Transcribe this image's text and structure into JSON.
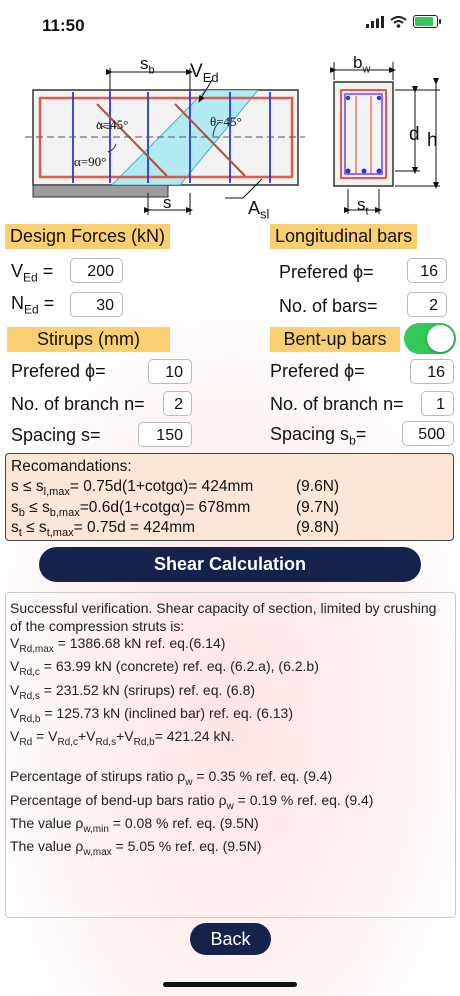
{
  "status_bar": {
    "time": "11:50"
  },
  "diagram_labels": {
    "sb": "s",
    "sb_sub": "b",
    "ved": "V",
    "ved_sub": "Ed",
    "alpha45": "α=45°",
    "theta45": "θ=45°",
    "alpha90": "α=90°",
    "s": "s",
    "asl": "A",
    "asl_sub": "sl",
    "bw": "b",
    "bw_sub": "w",
    "d": "d",
    "h": "h",
    "st": "s",
    "st_sub": "t"
  },
  "design_forces": {
    "title": "Design Forces (kN)",
    "ved_label": "V",
    "ved_sub": "Ed",
    "ved_value": "200",
    "ned_label": "N",
    "ned_sub": "Ed",
    "ned_value": "30"
  },
  "longitudinal": {
    "title": "Longitudinal bars",
    "phi_label": "Prefered ϕ=",
    "phi_value": "16",
    "bars_label": "No. of bars=",
    "bars_value": "2"
  },
  "stirups": {
    "title": "Stirups (mm)",
    "phi_label": "Prefered ϕ=",
    "phi_value": "10",
    "branch_label": "No. of branch n=",
    "branch_value": "2",
    "spacing_label": "Spacing s=",
    "spacing_value": "150"
  },
  "bentup": {
    "title": "Bent-up bars",
    "enabled": true,
    "phi_label": "Prefered ϕ=",
    "phi_value": "16",
    "branch_label": "No. of branch n=",
    "branch_value": "1",
    "spacing_label": "Spacing s",
    "spacing_sub": "b",
    "spacing_eq": "=",
    "spacing_value": "500"
  },
  "recommendations": {
    "title": "Recomandations:",
    "l1_a": "s ≤ s",
    "l1_sub": "l,max",
    "l1_b": "= 0.75d(1+cotgα)= 424mm",
    "l1_ref": "(9.6N)",
    "l2_a": "s",
    "l2_sub1": "b",
    "l2_b": " ≤ s",
    "l2_sub2": "b,max",
    "l2_c": "=0.6d(1+cotgα)= 678mm",
    "l2_ref": "(9.7N)",
    "l3_a": "s",
    "l3_sub1": "t",
    "l3_b": " ≤ s",
    "l3_sub2": "t,max",
    "l3_c": "= 0.75d = 424mm",
    "l3_ref": "(9.8N)"
  },
  "shear_button": "Shear Calculation",
  "results": {
    "intro": "Successful verification. Shear capacity of section, limited by crushing of the compression struts is:",
    "r1_a": "V",
    "r1_sub": "Rd,max",
    "r1_b": " = 1386.68 kN ref. eq.(6.14)",
    "r2_a": "V",
    "r2_sub": "Rd,c",
    "r2_b": " = 63.99 kN (concrete) ref. eq. (6.2.a), (6.2.b)",
    "r3_a": "V",
    "r3_sub": "Rd,s",
    "r3_b": " = 231.52 kN (srirups) ref. eq. (6.8)",
    "r4_a": "V",
    "r4_sub": "Rd,b",
    "r4_b": " = 125.73 kN (inclined bar) ref. eq. (6.13)",
    "r5_a": "V",
    "r5_sub": "Rd",
    "r5_b": " = V",
    "r5_sub2": "Rd,c",
    "r5_c": "+V",
    "r5_sub3": "Rd,s",
    "r5_d": "+V",
    "r5_sub4": "Rd,b",
    "r5_e": "= 421.24 kN.",
    "p1_a": "Percentage of stirups ratio ρ",
    "p1_sub": "w",
    "p1_b": " = 0.35 % ref. eq. (9.4)",
    "p2_a": "Percentage of bend-up bars ratio ρ",
    "p2_sub": "w",
    "p2_b": " = 0.19 % ref. eq. (9.4)",
    "p3_a": "The value ρ",
    "p3_sub": "w,min",
    "p3_b": " = 0.08 % ref. eq. (9.5N)",
    "p4_a": "The value ρ",
    "p4_sub": "w,max",
    "p4_b": " = 5.05 % ref. eq. (9.5N)"
  },
  "back_button": "Back",
  "colors": {
    "section_bg": "#f9cf72",
    "button_bg": "#15224b",
    "toggle_on": "#34c759"
  }
}
